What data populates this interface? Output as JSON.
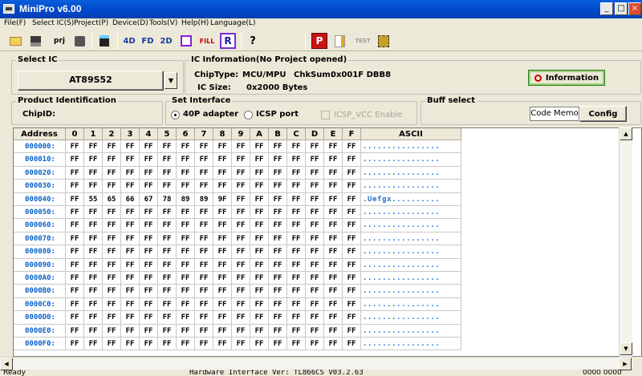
{
  "window": {
    "title": "MiniPro v6.00"
  },
  "menu": [
    "File(F)",
    "Select IC(S)",
    "Project(P)",
    "Device(D)",
    "Tools(V)",
    "Help(H)",
    "Language(L)"
  ],
  "toolbar": {
    "icons": [
      "open-icon",
      "save-icon",
      "project-icon",
      "save-project-icon",
      "device-icon",
      "4d-icon",
      "fd-icon",
      "2d-icon",
      "chip-select-icon",
      "fill-icon",
      "r-icon",
      "help-icon",
      "program-icon",
      "edit-icon",
      "test-icon",
      "chip-icon"
    ],
    "labels": {
      "prj": "prj",
      "fill": "FILL",
      "r": "R",
      "help": "?",
      "p": "P",
      "test": "TEST",
      "4d": "4D",
      "fd": "FD",
      "2d": "2D"
    }
  },
  "select_ic": {
    "label": "Select IC",
    "value": "AT89S52"
  },
  "ic_info": {
    "label": "IC Information(No Project opened)",
    "chip_type_label": "ChipType:",
    "chip_type": "MCU/MPU",
    "chksum_label": "ChkSum:",
    "chksum": "0x001F DBB8",
    "ic_size_label": "IC Size:",
    "ic_size": "0x2000 Bytes",
    "info_button": "Information"
  },
  "product_id": {
    "label": "Product Identification",
    "chip_id_label": "ChipID:"
  },
  "interface": {
    "label": "Set Interface",
    "options": [
      "40P adapter",
      "ICSP port"
    ],
    "selected": "40P adapter",
    "icsp_vcc": "ICSP_VCC Enable"
  },
  "buff": {
    "label": "Buff select",
    "current": "Code Memo",
    "config": "Config"
  },
  "grid": {
    "headers": [
      "Address",
      "0",
      "1",
      "2",
      "3",
      "4",
      "5",
      "6",
      "7",
      "8",
      "9",
      "A",
      "B",
      "C",
      "D",
      "E",
      "F",
      "ASCII"
    ],
    "rows": [
      {
        "addr": "000000:",
        "bytes": [
          "FF",
          "FF",
          "FF",
          "FF",
          "FF",
          "FF",
          "FF",
          "FF",
          "FF",
          "FF",
          "FF",
          "FF",
          "FF",
          "FF",
          "FF",
          "FF"
        ],
        "ascii": "................"
      },
      {
        "addr": "000010:",
        "bytes": [
          "FF",
          "FF",
          "FF",
          "FF",
          "FF",
          "FF",
          "FF",
          "FF",
          "FF",
          "FF",
          "FF",
          "FF",
          "FF",
          "FF",
          "FF",
          "FF"
        ],
        "ascii": "................"
      },
      {
        "addr": "000020:",
        "bytes": [
          "FF",
          "FF",
          "FF",
          "FF",
          "FF",
          "FF",
          "FF",
          "FF",
          "FF",
          "FF",
          "FF",
          "FF",
          "FF",
          "FF",
          "FF",
          "FF"
        ],
        "ascii": "................"
      },
      {
        "addr": "000030:",
        "bytes": [
          "FF",
          "FF",
          "FF",
          "FF",
          "FF",
          "FF",
          "FF",
          "FF",
          "FF",
          "FF",
          "FF",
          "FF",
          "FF",
          "FF",
          "FF",
          "FF"
        ],
        "ascii": "................"
      },
      {
        "addr": "000040:",
        "bytes": [
          "FF",
          "55",
          "65",
          "66",
          "67",
          "78",
          "89",
          "89",
          "9F",
          "FF",
          "FF",
          "FF",
          "FF",
          "FF",
          "FF",
          "FF"
        ],
        "ascii": ".Uefgx.........."
      },
      {
        "addr": "000050:",
        "bytes": [
          "FF",
          "FF",
          "FF",
          "FF",
          "FF",
          "FF",
          "FF",
          "FF",
          "FF",
          "FF",
          "FF",
          "FF",
          "FF",
          "FF",
          "FF",
          "FF"
        ],
        "ascii": "................"
      },
      {
        "addr": "000060:",
        "bytes": [
          "FF",
          "FF",
          "FF",
          "FF",
          "FF",
          "FF",
          "FF",
          "FF",
          "FF",
          "FF",
          "FF",
          "FF",
          "FF",
          "FF",
          "FF",
          "FF"
        ],
        "ascii": "................"
      },
      {
        "addr": "000070:",
        "bytes": [
          "FF",
          "FF",
          "FF",
          "FF",
          "FF",
          "FF",
          "FF",
          "FF",
          "FF",
          "FF",
          "FF",
          "FF",
          "FF",
          "FF",
          "FF",
          "FF"
        ],
        "ascii": "................"
      },
      {
        "addr": "000080:",
        "bytes": [
          "FF",
          "FF",
          "FF",
          "FF",
          "FF",
          "FF",
          "FF",
          "FF",
          "FF",
          "FF",
          "FF",
          "FF",
          "FF",
          "FF",
          "FF",
          "FF"
        ],
        "ascii": "................"
      },
      {
        "addr": "000090:",
        "bytes": [
          "FF",
          "FF",
          "FF",
          "FF",
          "FF",
          "FF",
          "FF",
          "FF",
          "FF",
          "FF",
          "FF",
          "FF",
          "FF",
          "FF",
          "FF",
          "FF"
        ],
        "ascii": "................"
      },
      {
        "addr": "0000A0:",
        "bytes": [
          "FF",
          "FF",
          "FF",
          "FF",
          "FF",
          "FF",
          "FF",
          "FF",
          "FF",
          "FF",
          "FF",
          "FF",
          "FF",
          "FF",
          "FF",
          "FF"
        ],
        "ascii": "................"
      },
      {
        "addr": "0000B0:",
        "bytes": [
          "FF",
          "FF",
          "FF",
          "FF",
          "FF",
          "FF",
          "FF",
          "FF",
          "FF",
          "FF",
          "FF",
          "FF",
          "FF",
          "FF",
          "FF",
          "FF"
        ],
        "ascii": "................"
      },
      {
        "addr": "0000C0:",
        "bytes": [
          "FF",
          "FF",
          "FF",
          "FF",
          "FF",
          "FF",
          "FF",
          "FF",
          "FF",
          "FF",
          "FF",
          "FF",
          "FF",
          "FF",
          "FF",
          "FF"
        ],
        "ascii": "................"
      },
      {
        "addr": "0000D0:",
        "bytes": [
          "FF",
          "FF",
          "FF",
          "FF",
          "FF",
          "FF",
          "FF",
          "FF",
          "FF",
          "FF",
          "FF",
          "FF",
          "FF",
          "FF",
          "FF",
          "FF"
        ],
        "ascii": "................"
      },
      {
        "addr": "0000E0:",
        "bytes": [
          "FF",
          "FF",
          "FF",
          "FF",
          "FF",
          "FF",
          "FF",
          "FF",
          "FF",
          "FF",
          "FF",
          "FF",
          "FF",
          "FF",
          "FF",
          "FF"
        ],
        "ascii": "................"
      },
      {
        "addr": "0000F0:",
        "bytes": [
          "FF",
          "FF",
          "FF",
          "FF",
          "FF",
          "FF",
          "FF",
          "FF",
          "FF",
          "FF",
          "FF",
          "FF",
          "FF",
          "FF",
          "FF",
          "FF"
        ],
        "ascii": "................"
      }
    ]
  },
  "status": {
    "left": "Ready",
    "middle": "Hardware Interface Ver: TL866CS V03.2.63",
    "right": "0000 0000"
  },
  "colors": {
    "titlebar": "#0a5fdb",
    "address": "#0a62c8",
    "ascii": "#1e6fd0",
    "face": "#ece9d8"
  }
}
